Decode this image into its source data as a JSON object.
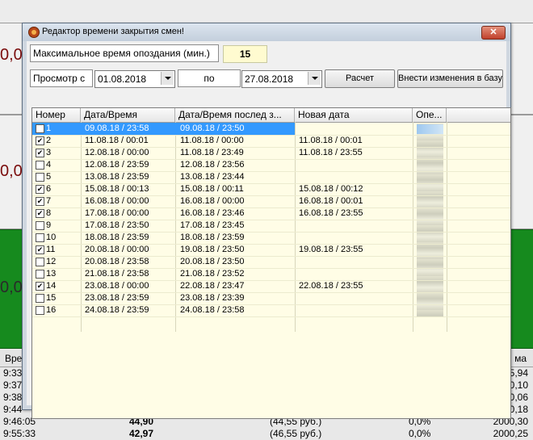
{
  "background": {
    "values": [
      "0,0",
      "0,0",
      "0,0"
    ],
    "table_head_left": "Вре",
    "table_head_right": "ма",
    "rows": [
      {
        "time": "9:33",
        "price": "",
        "paren": "",
        "pct": "",
        "sum": "5,94"
      },
      {
        "time": "9:37",
        "price": "",
        "paren": "",
        "pct": "",
        "sum": "0,10"
      },
      {
        "time": "9:38",
        "price": "",
        "paren": "",
        "pct": "",
        "sum": "0,06"
      },
      {
        "time": "9:44",
        "price": "",
        "paren": "",
        "pct": "",
        "sum": "0,18"
      },
      {
        "time": "9:46:05",
        "price": "44,90",
        "paren": "(44,55  руб.)",
        "pct": "0,0%",
        "sum": "2000,30"
      },
      {
        "time": "9:55:33",
        "price": "42,97",
        "paren": "(46,55  руб.)",
        "pct": "0,0%",
        "sum": "2000,25"
      }
    ]
  },
  "dialog": {
    "title": "Редактор времени закрытия смен!",
    "close_glyph": "✕",
    "max_delay_label": "Максимальное время опоздания (мин.)",
    "max_delay_value": "15",
    "view_from_label": "Просмотр с",
    "date_from": "01.08.2018",
    "to_label": "по",
    "date_to": "27.08.2018",
    "calc_button": "Расчет",
    "save_button": "Внести изменения в базу"
  },
  "grid": {
    "columns": [
      "Номер",
      "Дата/Время",
      "Дата/Время послед з...",
      "Новая дата",
      "Опе...",
      ""
    ],
    "rows": [
      {
        "checked": false,
        "num": "1",
        "dt": "09.08.18 / 23:58",
        "last": "09.08.18 / 23:50",
        "new": "",
        "selected": true
      },
      {
        "checked": true,
        "num": "2",
        "dt": "11.08.18 / 00:01",
        "last": "11.08.18 / 00:00",
        "new": "11.08.18 / 00:01",
        "selected": false
      },
      {
        "checked": true,
        "num": "3",
        "dt": "12.08.18 / 00:00",
        "last": "11.08.18 / 23:49",
        "new": "11.08.18 / 23:55",
        "selected": false
      },
      {
        "checked": false,
        "num": "4",
        "dt": "12.08.18 / 23:59",
        "last": "12.08.18 / 23:56",
        "new": "",
        "selected": false
      },
      {
        "checked": false,
        "num": "5",
        "dt": "13.08.18 / 23:59",
        "last": "13.08.18 / 23:44",
        "new": "",
        "selected": false
      },
      {
        "checked": true,
        "num": "6",
        "dt": "15.08.18 / 00:13",
        "last": "15.08.18 / 00:11",
        "new": "15.08.18 / 00:12",
        "selected": false
      },
      {
        "checked": true,
        "num": "7",
        "dt": "16.08.18 / 00:00",
        "last": "16.08.18 / 00:00",
        "new": "16.08.18 / 00:01",
        "selected": false
      },
      {
        "checked": true,
        "num": "8",
        "dt": "17.08.18 / 00:00",
        "last": "16.08.18 / 23:46",
        "new": "16.08.18 / 23:55",
        "selected": false
      },
      {
        "checked": false,
        "num": "9",
        "dt": "17.08.18 / 23:50",
        "last": "17.08.18 / 23:45",
        "new": "",
        "selected": false
      },
      {
        "checked": false,
        "num": "10",
        "dt": "18.08.18 / 23:59",
        "last": "18.08.18 / 23:59",
        "new": "",
        "selected": false
      },
      {
        "checked": true,
        "num": "11",
        "dt": "20.08.18 / 00:00",
        "last": "19.08.18 / 23:50",
        "new": "19.08.18 / 23:55",
        "selected": false
      },
      {
        "checked": false,
        "num": "12",
        "dt": "20.08.18 / 23:58",
        "last": "20.08.18 / 23:50",
        "new": "",
        "selected": false
      },
      {
        "checked": false,
        "num": "13",
        "dt": "21.08.18 / 23:58",
        "last": "21.08.18 / 23:52",
        "new": "",
        "selected": false
      },
      {
        "checked": true,
        "num": "14",
        "dt": "23.08.18 / 00:00",
        "last": "22.08.18 / 23:47",
        "new": "22.08.18 / 23:55",
        "selected": false
      },
      {
        "checked": false,
        "num": "15",
        "dt": "23.08.18 / 23:59",
        "last": "23.08.18 / 23:39",
        "new": "",
        "selected": false
      },
      {
        "checked": false,
        "num": "16",
        "dt": "24.08.18 / 23:59",
        "last": "24.08.18 / 23:58",
        "new": "",
        "selected": false
      }
    ]
  }
}
